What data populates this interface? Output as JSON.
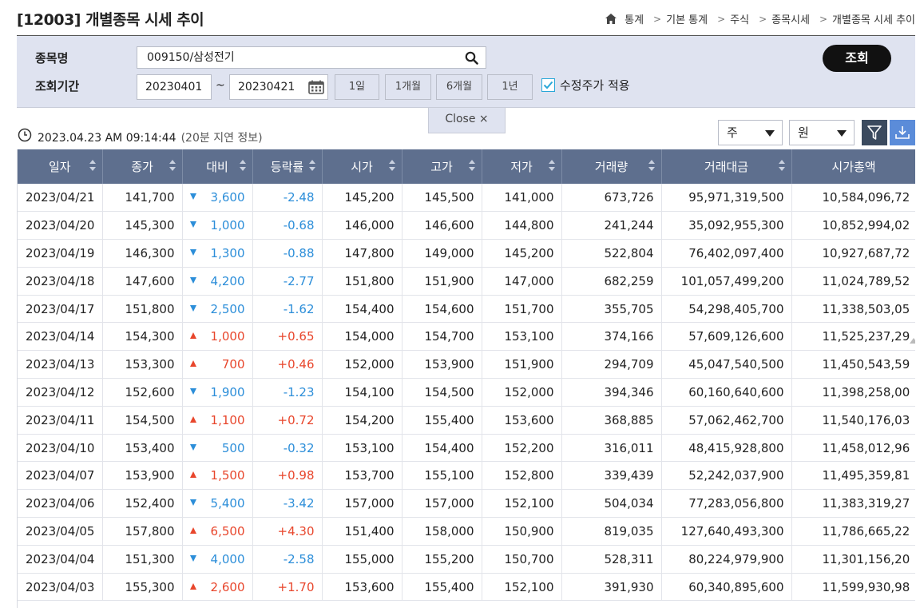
{
  "header": {
    "title": "[12003] 개별종목 시세 추이",
    "breadcrumb": [
      "통계",
      "기본 통계",
      "주식",
      "종목시세",
      "개별종목 시세 추이"
    ]
  },
  "search": {
    "stock_label": "종목명",
    "stock_value": "009150/삼성전기",
    "period_label": "조회기간",
    "start_date": "20230401",
    "tilde": "~",
    "end_date": "20230421",
    "period_buttons": [
      "1일",
      "1개월",
      "6개월",
      "1년"
    ],
    "adjusted_label": "수정주가 적용",
    "adjusted_checked": true,
    "query_button": "조회",
    "close_label": "Close ×"
  },
  "info": {
    "timestamp": "2023.04.23 AM 09:14:44",
    "delay_note": "(20분 지연 정보)"
  },
  "controls": {
    "unit_select": "주",
    "currency_select": "원"
  },
  "table": {
    "columns": [
      "일자",
      "종가",
      "대비",
      "등락률",
      "시가",
      "고가",
      "저가",
      "거래량",
      "거래대금",
      "시가총액"
    ],
    "rows": [
      {
        "date": "2023/04/21",
        "close": "141,700",
        "dir": "down",
        "change": "3,600",
        "rate": "-2.48",
        "open": "145,200",
        "high": "145,500",
        "low": "141,000",
        "volume": "673,726",
        "value": "95,971,319,500",
        "mcap": "10,584,096,72"
      },
      {
        "date": "2023/04/20",
        "close": "145,300",
        "dir": "down",
        "change": "1,000",
        "rate": "-0.68",
        "open": "146,000",
        "high": "146,600",
        "low": "144,800",
        "volume": "241,244",
        "value": "35,092,955,300",
        "mcap": "10,852,994,02"
      },
      {
        "date": "2023/04/19",
        "close": "146,300",
        "dir": "down",
        "change": "1,300",
        "rate": "-0.88",
        "open": "147,800",
        "high": "149,000",
        "low": "145,200",
        "volume": "522,804",
        "value": "76,402,097,400",
        "mcap": "10,927,687,72"
      },
      {
        "date": "2023/04/18",
        "close": "147,600",
        "dir": "down",
        "change": "4,200",
        "rate": "-2.77",
        "open": "151,800",
        "high": "151,900",
        "low": "147,000",
        "volume": "682,259",
        "value": "101,057,499,200",
        "mcap": "11,024,789,52"
      },
      {
        "date": "2023/04/17",
        "close": "151,800",
        "dir": "down",
        "change": "2,500",
        "rate": "-1.62",
        "open": "154,400",
        "high": "154,600",
        "low": "151,700",
        "volume": "355,705",
        "value": "54,298,405,700",
        "mcap": "11,338,503,05"
      },
      {
        "date": "2023/04/14",
        "close": "154,300",
        "dir": "up",
        "change": "1,000",
        "rate": "+0.65",
        "open": "154,000",
        "high": "154,700",
        "low": "153,100",
        "volume": "374,166",
        "value": "57,609,126,600",
        "mcap": "11,525,237,29"
      },
      {
        "date": "2023/04/13",
        "close": "153,300",
        "dir": "up",
        "change": "700",
        "rate": "+0.46",
        "open": "152,000",
        "high": "153,900",
        "low": "151,900",
        "volume": "294,709",
        "value": "45,047,540,500",
        "mcap": "11,450,543,59"
      },
      {
        "date": "2023/04/12",
        "close": "152,600",
        "dir": "down",
        "change": "1,900",
        "rate": "-1.23",
        "open": "154,100",
        "high": "154,500",
        "low": "152,000",
        "volume": "394,346",
        "value": "60,160,640,600",
        "mcap": "11,398,258,00"
      },
      {
        "date": "2023/04/11",
        "close": "154,500",
        "dir": "up",
        "change": "1,100",
        "rate": "+0.72",
        "open": "154,200",
        "high": "155,400",
        "low": "153,600",
        "volume": "368,885",
        "value": "57,062,462,700",
        "mcap": "11,540,176,03"
      },
      {
        "date": "2023/04/10",
        "close": "153,400",
        "dir": "down",
        "change": "500",
        "rate": "-0.32",
        "open": "153,100",
        "high": "154,400",
        "low": "152,200",
        "volume": "316,011",
        "value": "48,415,928,800",
        "mcap": "11,458,012,96"
      },
      {
        "date": "2023/04/07",
        "close": "153,900",
        "dir": "up",
        "change": "1,500",
        "rate": "+0.98",
        "open": "153,700",
        "high": "155,100",
        "low": "152,800",
        "volume": "339,439",
        "value": "52,242,037,900",
        "mcap": "11,495,359,81"
      },
      {
        "date": "2023/04/06",
        "close": "152,400",
        "dir": "down",
        "change": "5,400",
        "rate": "-3.42",
        "open": "157,000",
        "high": "157,000",
        "low": "152,100",
        "volume": "504,034",
        "value": "77,283,056,800",
        "mcap": "11,383,319,27"
      },
      {
        "date": "2023/04/05",
        "close": "157,800",
        "dir": "up",
        "change": "6,500",
        "rate": "+4.30",
        "open": "151,400",
        "high": "158,000",
        "low": "150,900",
        "volume": "819,035",
        "value": "127,640,493,300",
        "mcap": "11,786,665,22"
      },
      {
        "date": "2023/04/04",
        "close": "151,300",
        "dir": "down",
        "change": "4,000",
        "rate": "-2.58",
        "open": "155,000",
        "high": "155,200",
        "low": "150,700",
        "volume": "528,311",
        "value": "80,224,979,900",
        "mcap": "11,301,156,20"
      },
      {
        "date": "2023/04/03",
        "close": "155,300",
        "dir": "up",
        "change": "2,600",
        "rate": "+1.70",
        "open": "153,600",
        "high": "155,400",
        "low": "152,100",
        "volume": "391,930",
        "value": "60,340,895,600",
        "mcap": "11,599,930,98"
      }
    ]
  }
}
